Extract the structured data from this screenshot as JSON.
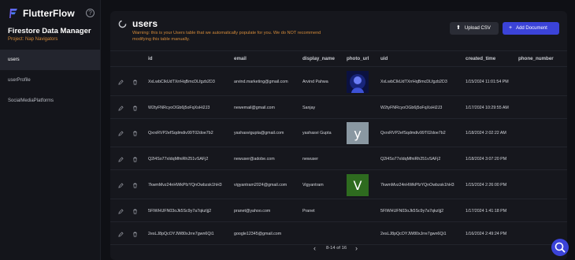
{
  "brand": {
    "name": "FlutterFlow"
  },
  "project": {
    "title": "Firestore Data Manager",
    "subtitle": "Project: Nap Navigators"
  },
  "sidebar": {
    "items": [
      {
        "label": "users"
      },
      {
        "label": "userProfile"
      },
      {
        "label": "SocialMediaPlatforms"
      }
    ]
  },
  "header": {
    "title": "users",
    "warning": "Warning: this is your Users table that we automatically populate for you. We do NOT recommend modifying this table manually.",
    "upload_label": "Upload CSV",
    "add_label": "Add Document"
  },
  "table": {
    "columns": [
      "id",
      "email",
      "display_name",
      "photo_url",
      "uid",
      "created_time",
      "phone_number"
    ],
    "rows": [
      {
        "id": "XxLwbCIkUdTXrrHqBmcDLfgzb2D3",
        "email": "arvind.marketing@gmail.com",
        "display_name": "Arvind Pahwa",
        "photo": "image",
        "uid": "XxLwbCIkUdTXrrHqBmcDLfgzb2D3",
        "created_time": "1/15/2024 11:01:54 PM"
      },
      {
        "id": "W2tyFNRcyoOGb6j5oFqXsHi2J3",
        "email": "newemail@gmail.com",
        "display_name": "Sanjay",
        "photo": "",
        "uid": "W2tyFNRcyoOGb6j5oFqXsHi2J3",
        "created_time": "1/17/2024 10:29:55 AM"
      },
      {
        "id": "QxrxRVP2efSqdmdiv99T02doe7b2",
        "email": "yashasvigupta@gmail.com",
        "display_name": "yashasvi Gupta",
        "photo": "y",
        "uid": "QxrxRVP2efSqdmdiv99T02doe7b2",
        "created_time": "1/18/2024 2:02:22 AM"
      },
      {
        "id": "Q2l4So77xIdqMfniRh251vSAFj2",
        "email": "newuser@adobe.com",
        "display_name": "newuser",
        "photo": "",
        "uid": "Q2l4So77xIdqMfniRh251vSAFj2",
        "created_time": "1/18/2024 3:07:20 PM"
      },
      {
        "id": "7kwmMvz24nHWkPfzYQnOwbzsk1hH3",
        "email": "vigyantram2024@gmail.com",
        "display_name": "Vigyantram",
        "photo": "V",
        "uid": "7kwmMvz24nHWkPfzYQnOwbzsk1hH3",
        "created_time": "1/15/2024 2:26:00 PM"
      },
      {
        "id": "5FIWHUFN03oJk5Sc9y7a7qkzIjj2",
        "email": "pranet@yahoo.com",
        "display_name": "Pranet",
        "photo": "",
        "uid": "5FIWHUFN03oJk5Sc9y7a7qkzIjj2",
        "created_time": "1/17/2024 1:41:18 PM"
      },
      {
        "id": "2esLJ8pQcOYJW80xJrre7gwn6Qi1",
        "email": "google12345@gmail.com",
        "display_name": "",
        "photo": "",
        "uid": "2esLJ8pQcOYJW80xJrre7gwn6Qi1",
        "created_time": "1/16/2024 2:49:24 PM"
      }
    ]
  },
  "pager": {
    "text": "8-14 of 16"
  },
  "colors": {
    "accent": "#3b43d8",
    "warning": "#d38a3a",
    "photo_y": "#8a98a2",
    "photo_v": "#2e6b1f"
  }
}
